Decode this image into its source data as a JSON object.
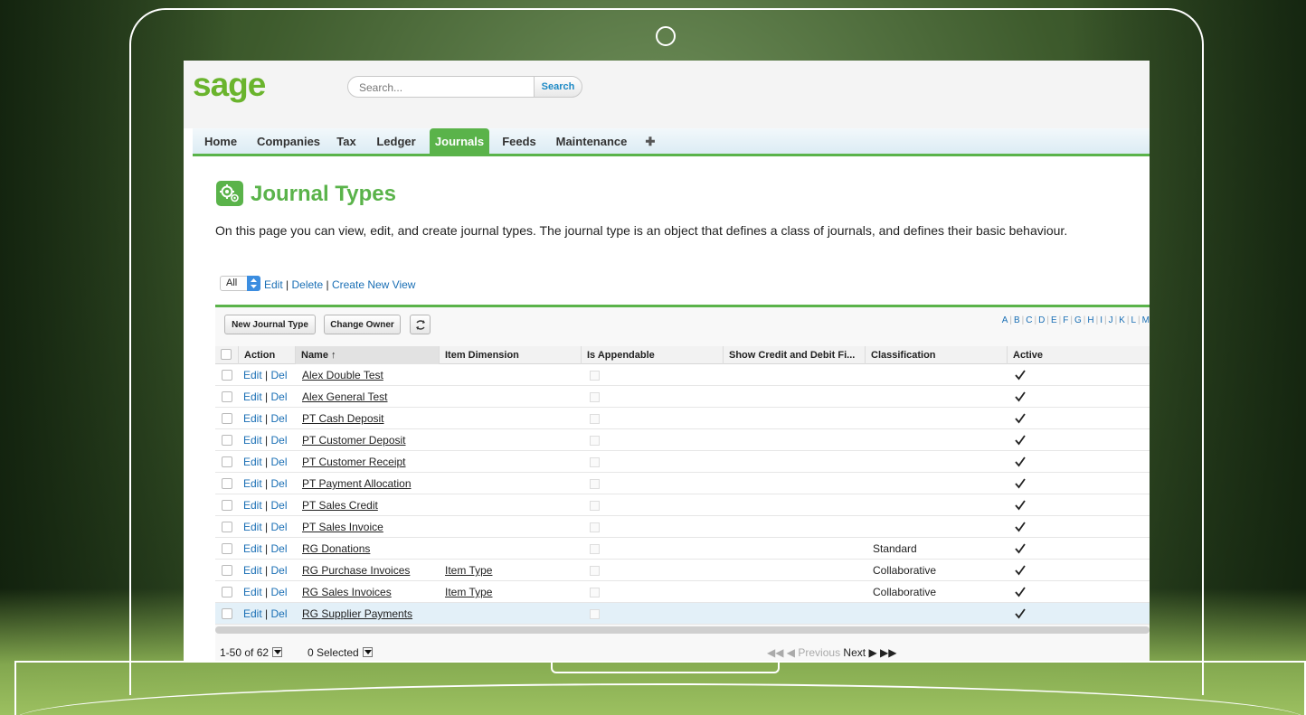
{
  "app": {
    "logo": "sage",
    "search_placeholder": "Search...",
    "search_button": "Search"
  },
  "tabs": [
    {
      "label": "Home"
    },
    {
      "label": "Companies"
    },
    {
      "label": "Tax"
    },
    {
      "label": "Ledger"
    },
    {
      "label": "Journals",
      "active": true
    },
    {
      "label": "Feeds"
    },
    {
      "label": "Maintenance"
    },
    {
      "label": "✚"
    }
  ],
  "page": {
    "title": "Journal Types",
    "description": "On this page you can view, edit, and create journal types. The journal type is an object that defines a class of journals, and defines their basic behaviour.",
    "icon": "gears-icon"
  },
  "view": {
    "selected": "All",
    "edit": "Edit",
    "delete": "Delete",
    "create_new_view": "Create New View",
    "separator": " | "
  },
  "toolbar": {
    "new_journal_type": "New Journal Type",
    "change_owner": "Change Owner",
    "refresh_icon": "refresh-icon"
  },
  "alphabet": [
    "A",
    "B",
    "C",
    "D",
    "E",
    "F",
    "G",
    "H",
    "I",
    "J",
    "K",
    "L",
    "M"
  ],
  "columns": {
    "action": "Action",
    "name": "Name ↑",
    "item_dimension": "Item Dimension",
    "is_appendable": "Is Appendable",
    "show_credit_debit": "Show Credit and Debit Fi...",
    "classification": "Classification",
    "active": "Active"
  },
  "row_actions": {
    "edit": "Edit",
    "sep": " | ",
    "del": "Del"
  },
  "rows": [
    {
      "name": "Alex Double Test",
      "item_dimension": "",
      "classification": ""
    },
    {
      "name": "Alex General Test",
      "item_dimension": "",
      "classification": ""
    },
    {
      "name": "PT Cash Deposit",
      "item_dimension": "",
      "classification": ""
    },
    {
      "name": "PT Customer Deposit",
      "item_dimension": "",
      "classification": ""
    },
    {
      "name": "PT Customer Receipt",
      "item_dimension": "",
      "classification": ""
    },
    {
      "name": "PT Payment Allocation",
      "item_dimension": "",
      "classification": ""
    },
    {
      "name": "PT Sales Credit",
      "item_dimension": "",
      "classification": ""
    },
    {
      "name": "PT Sales Invoice",
      "item_dimension": "",
      "classification": ""
    },
    {
      "name": "RG Donations",
      "item_dimension": "",
      "classification": "Standard"
    },
    {
      "name": "RG Purchase Invoices",
      "item_dimension": "Item Type",
      "classification": "Collaborative"
    },
    {
      "name": "RG Sales Invoices",
      "item_dimension": "Item Type",
      "classification": "Collaborative"
    },
    {
      "name": "RG Supplier Payments",
      "item_dimension": "",
      "classification": "",
      "highlighted": true
    }
  ],
  "footer": {
    "range": "1-50 of 62",
    "selected": "0 Selected",
    "previous": "Previous",
    "next": "Next"
  },
  "colors": {
    "brand_green": "#5ab34a",
    "logo_green": "#6ab42d",
    "link_blue": "#1a6fb5"
  }
}
